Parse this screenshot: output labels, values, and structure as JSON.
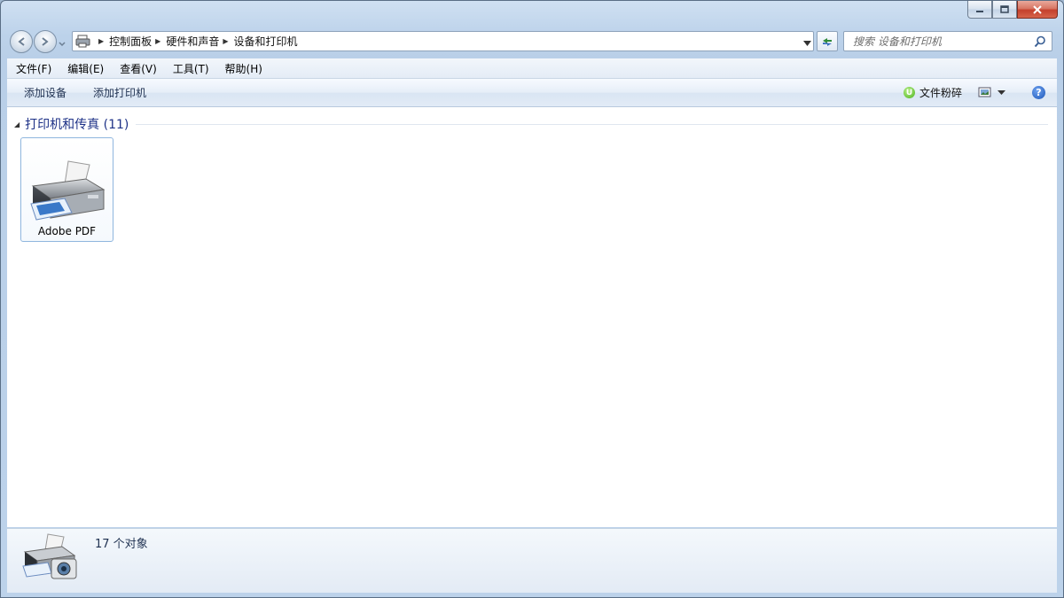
{
  "breadcrumb": {
    "items": [
      "控制面板",
      "硬件和声音",
      "设备和打印机"
    ]
  },
  "search": {
    "placeholder": "搜索 设备和打印机"
  },
  "menu": {
    "items": [
      "文件(F)",
      "编辑(E)",
      "查看(V)",
      "工具(T)",
      "帮助(H)"
    ]
  },
  "commands": {
    "add_device": "添加设备",
    "add_printer": "添加打印机",
    "shred_badge": "U",
    "shred": "文件粉碎",
    "help": "?"
  },
  "group": {
    "title": "打印机和传真 (11)"
  },
  "devices": [
    {
      "name": "Adobe PDF"
    }
  ],
  "details": {
    "count": "17 个对象"
  },
  "icons": {
    "printer": "printer-icon",
    "printer_camera": "printer-camera-icon",
    "search": "search-icon",
    "refresh": "refresh-icon"
  }
}
